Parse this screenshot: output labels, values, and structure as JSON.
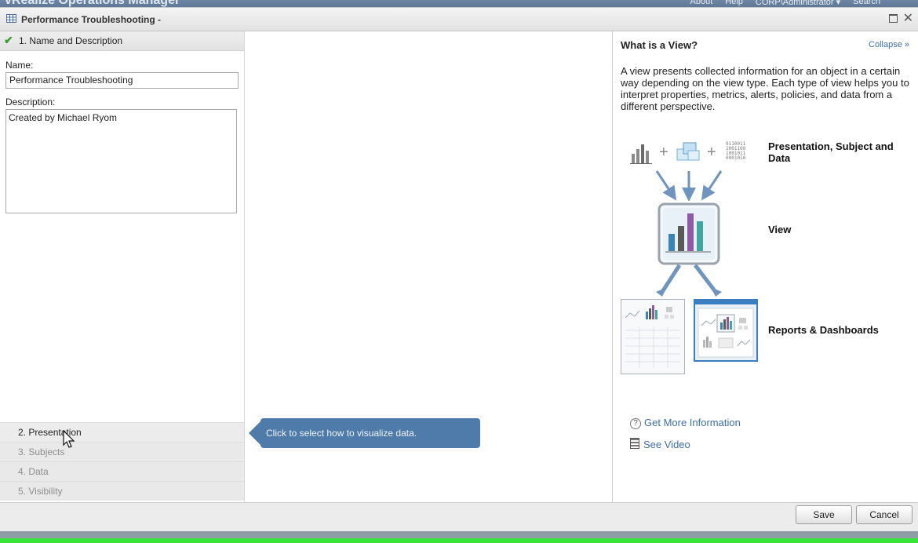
{
  "header": {
    "app_title": "vRealize Operations Manager",
    "links": [
      "About",
      "Help",
      "CORP\\Administrator ▾",
      "Search"
    ]
  },
  "dialog": {
    "title": "Performance Troubleshooting -"
  },
  "wizard": {
    "step1_label": "1. Name and Description",
    "name_label": "Name:",
    "name_value": "Performance Troubleshooting",
    "description_label": "Description:",
    "description_value": "Created by Michael Ryom",
    "steps": [
      {
        "label": "2. Presentation",
        "state": "active"
      },
      {
        "label": "3. Subjects",
        "state": "disabled"
      },
      {
        "label": "4. Data",
        "state": "disabled"
      },
      {
        "label": "5. Visibility",
        "state": "disabled"
      }
    ]
  },
  "tooltip": {
    "text": "Click to select how to visualize data."
  },
  "help": {
    "title": "What is a View?",
    "collapse": "Collapse »",
    "description": "A view presents collected information for an object in a certain way depending on the view type. Each type of view helps you to interpret properties, metrics, alerts, policies, and data from a different perspective.",
    "diagram_label_1": "Presentation, Subject and Data",
    "diagram_label_2": "View",
    "diagram_label_3": "Reports & Dashboards",
    "binary_lines": [
      "0110011",
      "1001100",
      "1001011",
      "0001010"
    ],
    "get_more": "Get More Information",
    "see_video": "See Video"
  },
  "footer": {
    "save": "Save",
    "cancel": "Cancel"
  },
  "colors": {
    "accent": "#4f7bab",
    "link": "#3d6ea8",
    "check": "#3c9a2e"
  }
}
